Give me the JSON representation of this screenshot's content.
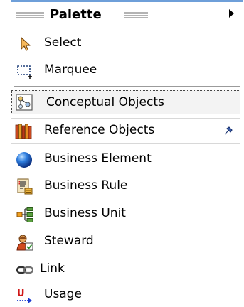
{
  "palette": {
    "title": "Palette",
    "tools": [
      {
        "label": "Select",
        "icon": "arrow-select-icon"
      },
      {
        "label": "Marquee",
        "icon": "marquee-icon"
      }
    ],
    "drawers": [
      {
        "label": "Conceptual Objects",
        "icon": "conceptual-objects-icon",
        "selected": true
      },
      {
        "label": "Reference Objects",
        "icon": "books-icon",
        "pinned": true
      }
    ],
    "objects": [
      {
        "label": "Business Element",
        "icon": "blue-sphere-icon"
      },
      {
        "label": "Business Rule",
        "icon": "business-rule-icon"
      },
      {
        "label": "Business Unit",
        "icon": "org-chart-icon"
      },
      {
        "label": "Steward",
        "icon": "steward-person-icon"
      },
      {
        "label": "Link",
        "icon": "link-chain-icon"
      },
      {
        "label": "Usage",
        "icon": "usage-arrow-icon"
      }
    ]
  }
}
